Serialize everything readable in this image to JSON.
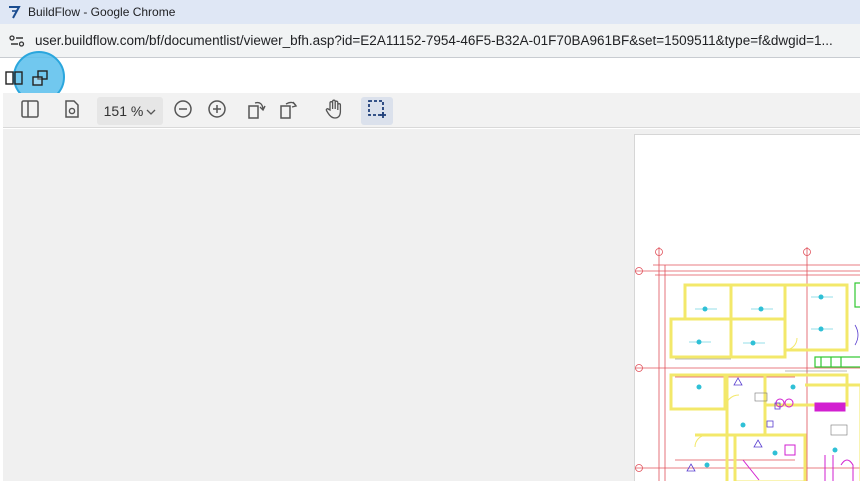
{
  "window": {
    "title": "BuildFlow - Google Chrome"
  },
  "address_bar": {
    "url": "user.buildflow.com/bf/documentlist/viewer_bfh.asp?id=E2A11152-7954-46F5-B32A-01F70BA961BF&set=1509511&type=f&dwgid=1..."
  },
  "viewer": {
    "zoom_label": "151 %",
    "toolbar_icons": [
      "sidebar-toggle-icon",
      "page-settings-icon",
      "zoom-out-icon",
      "zoom-in-icon",
      "rotate-left-icon",
      "rotate-right-icon",
      "pan-hand-icon",
      "area-select-icon"
    ]
  },
  "colors": {
    "title_bar": "#dfe7f5",
    "toolbar": "#f2f2f2",
    "highlight": "#58beec",
    "drawing_red": "#e0505a",
    "drawing_yellow": "#f3e86a",
    "drawing_cyan": "#2fc0d6",
    "drawing_magenta": "#d21fd0",
    "drawing_green": "#30c830"
  }
}
